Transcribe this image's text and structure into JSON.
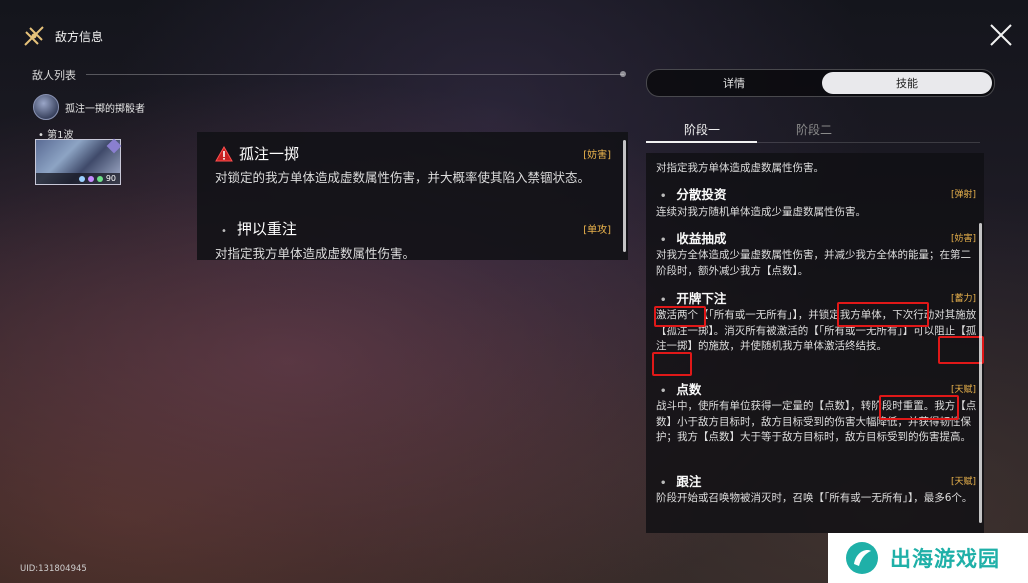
{
  "header": {
    "title": "敌方信息"
  },
  "enemy_list": {
    "title": "敌人列表",
    "enemy_name": "孤注一掷的掷骰者",
    "wave": "第1波",
    "card_level": "90"
  },
  "popup": {
    "skill_name": "孤注一掷",
    "skill_tag": "[妨害]",
    "skill_desc": "对锁定的我方单体造成虚数属性伤害，并大概率使其陷入禁锢状态。",
    "sub_name": "押以重注",
    "sub_tag": "[单攻]",
    "sub_desc": "对指定我方单体造成虚数属性伤害。"
  },
  "tabs": {
    "detail": "详情",
    "skill": "技能"
  },
  "phases": {
    "phase1": "阶段一",
    "phase2": "阶段二"
  },
  "skills": {
    "top_desc": "对指定我方单体造成虚数属性伤害。",
    "s1": {
      "name": "分散投资",
      "tag": "[弹射]",
      "desc": "连续对我方随机单体造成少量虚数属性伤害。"
    },
    "s2": {
      "name": "收益抽成",
      "tag": "[妨害]",
      "desc": "对我方全体造成少量虚数属性伤害，并减少我方全体的能量；在第二阶段时，额外减少我方【点数】。"
    },
    "s3": {
      "name": "开牌下注",
      "tag": "[蓄力]",
      "desc": "激活两个【「所有或一无所有」】，并锁定我方单体，下次行动对其施放【孤注一掷】。消灭所有被激活的【「所有或一无所有」】可以阻止【孤注一掷】的施放，并使随机我方单体激活终结技。"
    },
    "s4": {
      "name": "点数",
      "tag": "[天赋]",
      "desc": "战斗中，使所有单位获得一定量的【点数】，转阶段时重置。我方【点数】小于敌方目标时，敌方目标受到的伤害大幅降低，并获得韧性保护；我方【点数】大于等于敌方目标时，敌方目标受到的伤害提高。"
    },
    "s5": {
      "name": "跟注",
      "tag": "[天赋]",
      "desc": "阶段开始或召唤物被消灭时，召唤【「所有或一无所有」】，最多6个。"
    }
  },
  "uid": "UID:131804945",
  "watermark": "出海游戏园",
  "colors": {
    "accent_tag": "#e9b24c",
    "highlight": "#e01818",
    "watermark": "#1fb0a8"
  }
}
